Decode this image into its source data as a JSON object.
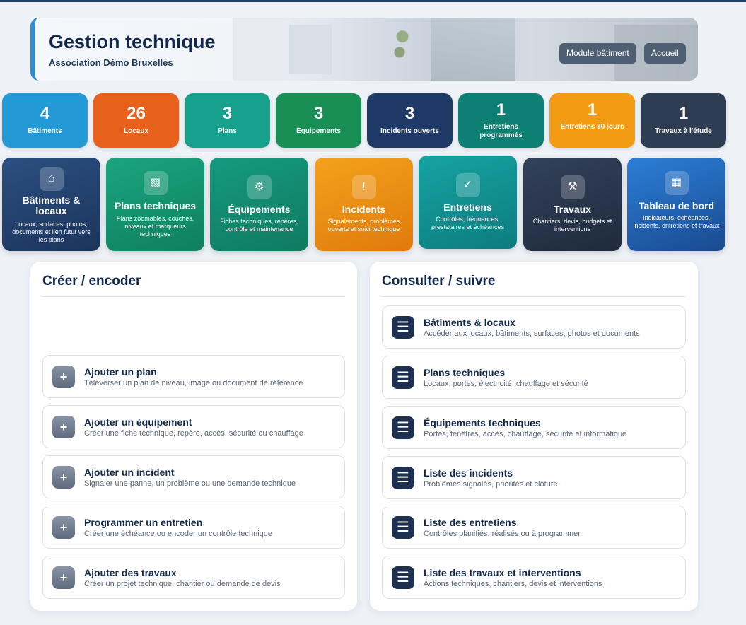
{
  "header": {
    "title": "Gestion technique",
    "subtitle": "Association Démo Bruxelles",
    "buttons": {
      "module": "Module bâtiment",
      "home": "Accueil"
    }
  },
  "stats": [
    {
      "value": "4",
      "label": "Bâtiments",
      "color": "#239ad6"
    },
    {
      "value": "26",
      "label": "Locaux",
      "color": "#e8611c"
    },
    {
      "value": "3",
      "label": "Plans",
      "color": "#17a08c"
    },
    {
      "value": "3",
      "label": "Équipements",
      "color": "#1a8f55"
    },
    {
      "value": "3",
      "label": "Incidents ouverts",
      "color": "#1f3a66"
    },
    {
      "value": "1",
      "label": "Entretiens programmés",
      "color": "#0e7f73"
    },
    {
      "value": "1",
      "label": "Entretiens 30 jours",
      "color": "#f39b13"
    },
    {
      "value": "1",
      "label": "Travaux à l'étude",
      "color": "#2f3d52"
    }
  ],
  "modules": [
    {
      "icon": "⌂",
      "icon_name": "home-icon",
      "title": "Bâtiments & locaux",
      "desc": "Locaux, surfaces, photos, documents et lien futur vers les plans",
      "bg": "linear-gradient(160deg,#2a4f80,#1c355c)"
    },
    {
      "icon": "▧",
      "icon_name": "plan-icon",
      "title": "Plans techniques",
      "desc": "Plans zoomables, couches, niveaux et marqueurs techniques",
      "bg": "linear-gradient(160deg,#1aa57f,#0f7f5f)"
    },
    {
      "icon": "⚙",
      "icon_name": "gear-icon",
      "title": "Équipements",
      "desc": "Fiches techniques, repères, contrôle et maintenance",
      "bg": "linear-gradient(160deg,#159a7f,#0f7a60)"
    },
    {
      "icon": "!",
      "icon_name": "alert-icon",
      "title": "Incidents",
      "desc": "Signalements, problèmes ouverts et suivi technique",
      "bg": "linear-gradient(160deg,#f3a21c,#e07a0c)"
    },
    {
      "icon": "✓",
      "icon_name": "check-icon",
      "title": "Entretiens",
      "desc": "Contrôles, fréquences, prestataires et échéances",
      "bg": "linear-gradient(160deg,#16a3a0,#0c7c80)"
    },
    {
      "icon": "⚒",
      "icon_name": "tools-icon",
      "title": "Travaux",
      "desc": "Chantiers, devis, budgets et interventions",
      "bg": "linear-gradient(160deg,#33415a,#1e2a3d)"
    },
    {
      "icon": "▦",
      "icon_name": "grid-icon",
      "title": "Tableau de bord",
      "desc": "Indicateurs, échéances, incidents, entretiens et travaux",
      "bg": "linear-gradient(160deg,#2b7fd8,#1a4a8f)"
    }
  ],
  "create_panel": {
    "title": "Créer / encoder",
    "items": [
      {
        "title": "Ajouter un plan",
        "desc": "Téléverser un plan de niveau, image ou document de référence"
      },
      {
        "title": "Ajouter un équipement",
        "desc": "Créer une fiche technique, repère, accès, sécurité ou chauffage"
      },
      {
        "title": "Ajouter un incident",
        "desc": "Signaler une panne, un problème ou une demande technique"
      },
      {
        "title": "Programmer un entretien",
        "desc": "Créer une échéance ou encoder un contrôle technique"
      },
      {
        "title": "Ajouter des travaux",
        "desc": "Créer un projet technique, chantier ou demande de devis"
      }
    ]
  },
  "consult_panel": {
    "title": "Consulter / suivre",
    "items": [
      {
        "title": "Bâtiments & locaux",
        "desc": "Accéder aux locaux, bâtiments, surfaces, photos et documents"
      },
      {
        "title": "Plans techniques",
        "desc": "Locaux, portes, électricité, chauffage et sécurité"
      },
      {
        "title": "Équipements techniques",
        "desc": "Portes, fenêtres, accès, chauffage, sécurité et informatique"
      },
      {
        "title": "Liste des incidents",
        "desc": "Problèmes signalés, priorités et clôture"
      },
      {
        "title": "Liste des entretiens",
        "desc": "Contrôles planifiés, réalisés ou à programmer"
      },
      {
        "title": "Liste des travaux et interventions",
        "desc": "Actions techniques, chantiers, devis et interventions"
      }
    ]
  }
}
